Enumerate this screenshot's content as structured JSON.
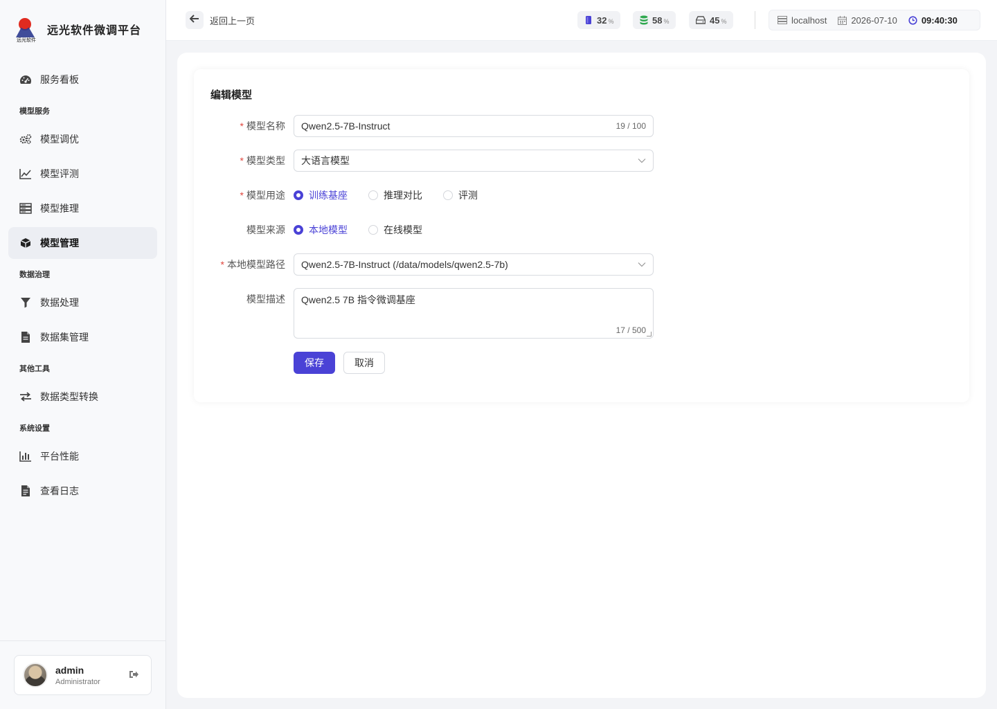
{
  "brand": {
    "name": "远光软件微调平台",
    "logo_text": "远光软件"
  },
  "sidebar": {
    "top_item": {
      "label": "服务看板",
      "icon": "dashboard-icon"
    },
    "groups": [
      {
        "title": "模型服务",
        "items": [
          {
            "label": "模型调优",
            "icon": "gears-icon"
          },
          {
            "label": "模型评测",
            "icon": "line-chart-icon"
          },
          {
            "label": "模型推理",
            "icon": "server-icon"
          },
          {
            "label": "模型管理",
            "icon": "cube-icon",
            "active": true
          }
        ]
      },
      {
        "title": "数据治理",
        "items": [
          {
            "label": "数据处理",
            "icon": "filter-icon"
          },
          {
            "label": "数据集管理",
            "icon": "file-icon"
          }
        ]
      },
      {
        "title": "其他工具",
        "items": [
          {
            "label": "数据类型转换",
            "icon": "swap-icon"
          }
        ]
      },
      {
        "title": "系统设置",
        "items": [
          {
            "label": "平台性能",
            "icon": "bar-chart-icon"
          },
          {
            "label": "查看日志",
            "icon": "file-text-icon"
          }
        ]
      }
    ]
  },
  "user": {
    "name": "admin",
    "role": "Administrator"
  },
  "topbar": {
    "back_label": "返回上一页",
    "metrics": [
      {
        "value": "32",
        "unit": "%",
        "icon": "memory-icon",
        "color": "#4a42d6"
      },
      {
        "value": "58",
        "unit": "%",
        "icon": "database-icon",
        "color": "#2fa84f"
      },
      {
        "value": "45",
        "unit": "%",
        "icon": "disk-icon",
        "color": "#555555"
      }
    ],
    "host": "localhost",
    "date": "2026-07-10",
    "time": "09:40:30"
  },
  "form": {
    "title": "编辑模型",
    "name": {
      "label": "模型名称",
      "value": "Qwen2.5-7B-Instruct",
      "counter": "19 / 100"
    },
    "type": {
      "label": "模型类型",
      "value": "大语言模型"
    },
    "purpose": {
      "label": "模型用途",
      "options": [
        "训练基座",
        "推理对比",
        "评测"
      ],
      "selected": "训练基座"
    },
    "source": {
      "label": "模型来源",
      "options": [
        "本地模型",
        "在线模型"
      ],
      "selected": "本地模型"
    },
    "path": {
      "label": "本地模型路径",
      "value": "Qwen2.5-7B-Instruct (/data/models/qwen2.5-7b)"
    },
    "desc": {
      "label": "模型描述",
      "value": "Qwen2.5 7B 指令微调基座",
      "counter": "17 / 500"
    },
    "save_label": "保存",
    "cancel_label": "取消"
  },
  "colors": {
    "accent": "#4a42d6",
    "required": "#e0463d"
  }
}
